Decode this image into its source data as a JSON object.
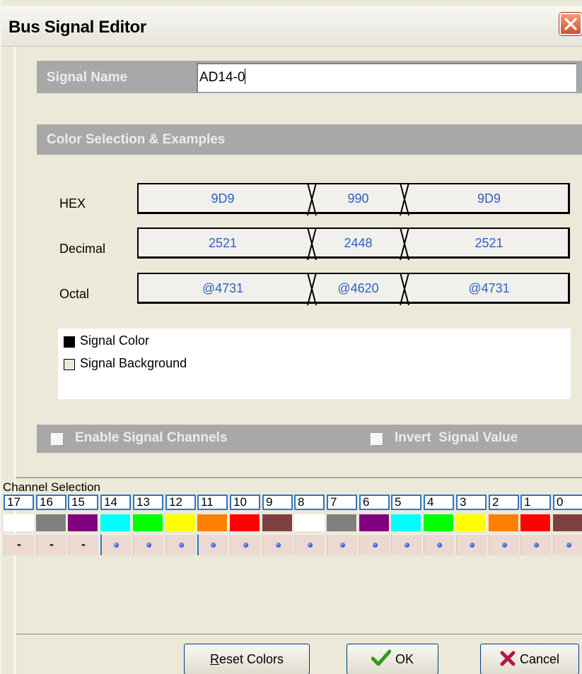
{
  "window": {
    "title": "Bus Signal Editor"
  },
  "signal_name": {
    "label": "Signal Name",
    "value": "AD14-0"
  },
  "color_section": {
    "label": "Color Selection & Examples"
  },
  "formats": [
    {
      "label": "HEX",
      "values": [
        "9D9",
        "990",
        "9D9"
      ]
    },
    {
      "label": "Decimal",
      "values": [
        "2521",
        "2448",
        "2521"
      ]
    },
    {
      "label": "Octal",
      "values": [
        "@4731",
        "@4620",
        "@4731"
      ]
    }
  ],
  "examples": {
    "signal_color": {
      "label": "Signal Color",
      "color": "#000000"
    },
    "signal_background": {
      "label": "Signal Background",
      "color": "#ece9d8"
    }
  },
  "options": {
    "enable_channels": "Enable Signal Channels",
    "invert_value": "Invert  Signal Value"
  },
  "channels": {
    "title": "Channel Selection",
    "items": [
      {
        "num": "17",
        "color": "#ffffff",
        "mode": "-"
      },
      {
        "num": "16",
        "color": "#808080",
        "mode": "-"
      },
      {
        "num": "15",
        "color": "#800080",
        "mode": "-"
      },
      {
        "num": "14",
        "color": "#00ffff",
        "mode": "dot"
      },
      {
        "num": "13",
        "color": "#00ff00",
        "mode": "dot"
      },
      {
        "num": "12",
        "color": "#ffff00",
        "mode": "dot"
      },
      {
        "num": "11",
        "color": "#ff8000",
        "mode": "dot"
      },
      {
        "num": "10",
        "color": "#ff0000",
        "mode": "dot"
      },
      {
        "num": "9",
        "color": "#804040",
        "mode": "dot"
      },
      {
        "num": "8",
        "color": "#ffffff",
        "mode": "dot"
      },
      {
        "num": "7",
        "color": "#808080",
        "mode": "dot"
      },
      {
        "num": "6",
        "color": "#800080",
        "mode": "dot"
      },
      {
        "num": "5",
        "color": "#00ffff",
        "mode": "dot"
      },
      {
        "num": "4",
        "color": "#00ff00",
        "mode": "dot"
      },
      {
        "num": "3",
        "color": "#ffff00",
        "mode": "dot"
      },
      {
        "num": "2",
        "color": "#ff8000",
        "mode": "dot"
      },
      {
        "num": "1",
        "color": "#ff0000",
        "mode": "dot"
      },
      {
        "num": "0",
        "color": "#804040",
        "mode": "dot"
      }
    ]
  },
  "buttons": {
    "reset": "Reset Colors",
    "reset_mnemonic": "R",
    "reset_rest": "eset Colors",
    "ok": "OK",
    "cancel": "Cancel"
  },
  "colors": {
    "value_text": "#2a62c4",
    "band_gray": "#a8a8a8",
    "channel_border": "#2c77c6"
  },
  "icons": {
    "close": "close-x-icon",
    "ok": "checkmark-icon",
    "cancel": "red-x-icon"
  }
}
